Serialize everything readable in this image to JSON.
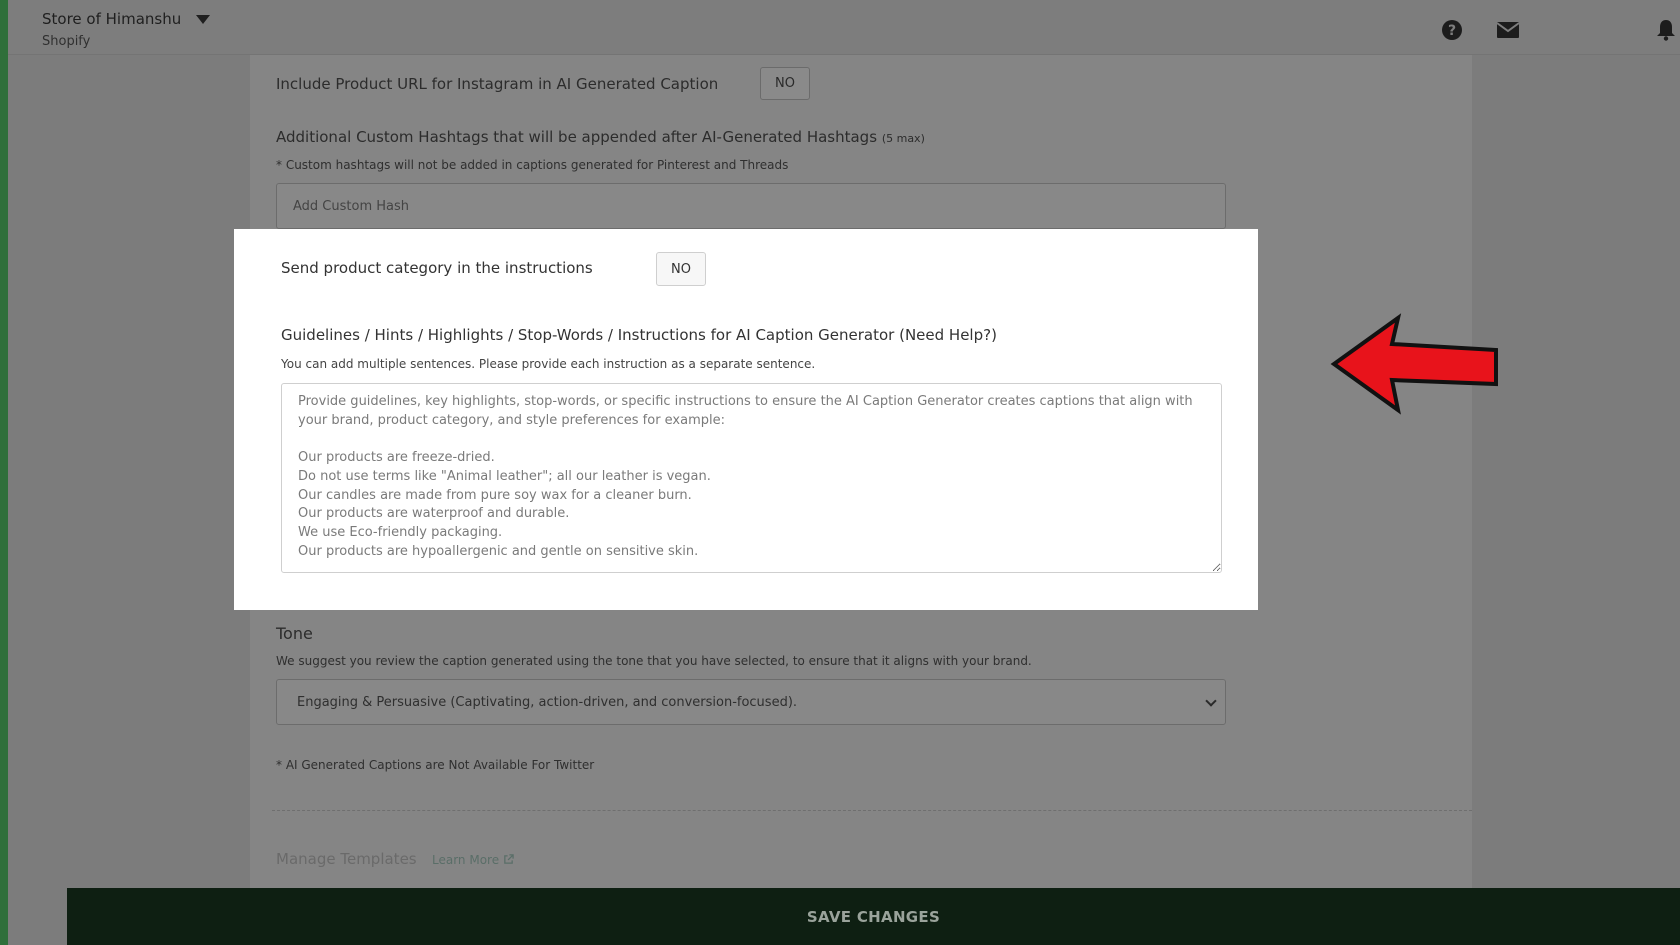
{
  "header": {
    "store_name": "Store of Himanshu",
    "platform": "Shopify",
    "icons": [
      "help-icon",
      "mail-icon",
      "bell-icon"
    ]
  },
  "settings": {
    "instagram_url_label": "Include Product URL for Instagram in AI Generated Caption",
    "instagram_url_value": "NO",
    "hashtags_title": "Additional Custom Hashtags that will be appended after AI-Generated Hashtags",
    "hashtags_max": "(5 max)",
    "hashtags_note": "* Custom hashtags will not be added in captions generated for Pinterest and Threads",
    "hashtags_placeholder": "Add Custom Hash",
    "category_label": "Send product category in the instructions",
    "category_value": "NO",
    "guidelines_title": "Guidelines / Hints / Highlights / Stop-Words / Instructions for AI Caption Generator",
    "guidelines_help": "(Need Help?)",
    "guidelines_desc": "You can add multiple sentences. Please provide each instruction as a separate sentence.",
    "guidelines_placeholder": "Provide guidelines, key highlights, stop-words, or specific instructions to ensure the AI Caption Generator creates captions that align with your brand, product category, and style preferences for example:\n\nOur products are freeze-dried.\nDo not use terms like \"Animal leather\"; all our leather is vegan.\nOur candles are made from pure soy wax for a cleaner burn.\nOur products are waterproof and durable.\nWe use Eco-friendly packaging.\nOur products are hypoallergenic and gentle on sensitive skin.",
    "tone_title": "Tone",
    "tone_desc": "We suggest you review the caption generated using the tone that you have selected, to ensure that it aligns with your brand.",
    "tone_selected": "Engaging & Persuasive (Captivating, action-driven, and conversion-focused).",
    "twitter_note": "* AI Generated Captions are Not Available For Twitter",
    "manage_templates": "Manage Templates",
    "learn_more": "Learn More"
  },
  "footer": {
    "save_label": "SAVE CHANGES"
  },
  "colors": {
    "overlay_gray": "#7c7c7c",
    "highlight_bg": "#ffffff",
    "save_bar": "#0e1f12",
    "arrow_red": "#e8131b"
  }
}
